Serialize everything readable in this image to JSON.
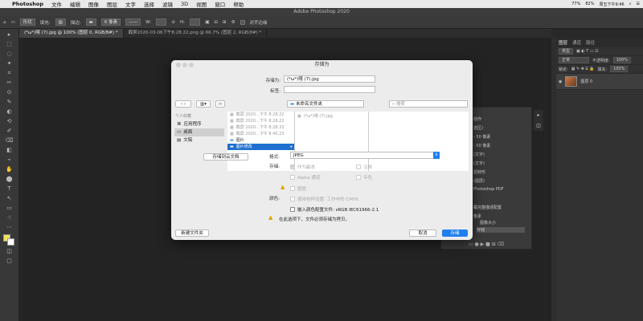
{
  "menubar": {
    "app": "Photoshop",
    "items": [
      "文件",
      "编辑",
      "图像",
      "图层",
      "文字",
      "选择",
      "滤镜",
      "3D",
      "视图",
      "窗口",
      "帮助"
    ],
    "status": {
      "battery": "77%",
      "wifi": "82%",
      "clock": "周五下午9:46"
    }
  },
  "ps_title": "Adobe Photoshop 2020",
  "options": {
    "shape": "形状",
    "fill": "填充:",
    "stroke": "描边:",
    "stroke_size": "6 像素",
    "w": "W:",
    "h": "H:",
    "align_edges": "对齐边缘"
  },
  "tabs": [
    "(*ω*)嘻 (7).jpg @ 100% (图层 0, RGB/8#) *",
    "截屏2020-03-06下午8.28.22.png @ 66.7% (图层 2, RGB/8#) *"
  ],
  "tools": [
    "▸",
    "⬚",
    "◌",
    "✦",
    "⌗",
    "✂",
    "⊙",
    "✎",
    "◐",
    "⟲",
    "✐",
    "⌫",
    "◧",
    "⌁",
    "✋",
    "⬤",
    "T",
    "↖",
    "▭",
    "☝",
    "⋯"
  ],
  "right_panel": {
    "tabs": [
      "图层",
      "通道",
      "路径"
    ],
    "kind": "类型",
    "blend": "正常",
    "opacity_label": "不透明度:",
    "opacity": "100%",
    "lock_label": "锁定:",
    "fill_label": "填充:",
    "fill": "100%",
    "layer_name": "图层 0"
  },
  "history": [
    "动作",
    "选区)",
    "- 50 像素",
    "- 50 像素",
    "(文字)",
    "(文字)",
    "扭转形",
    "(图层)",
    "Photoshop PDF",
    "",
    "覆完整描述配置",
    "像素",
    "图像大小",
    "存储"
  ],
  "dialog": {
    "title": "存储为",
    "save_as_label": "存储为:",
    "save_as_value": "(*ω*)嘻 (7).jpg",
    "tags_label": "标签:",
    "location": "未命名文件夹",
    "search_placeholder": "搜索",
    "sidebar_header": "个人收藏",
    "sidebar": [
      "应用程序",
      "桌面",
      "文稿"
    ],
    "col1": [
      "截屏 2020...下午 8.28.22",
      "截屏 2020...下午 8.28.22",
      "截屏 2020...下午 8.28.33",
      "截屏 2020...下午 8.40.23",
      "图片",
      "图片修改"
    ],
    "col2": [
      "(*ω*)嘻 (7).jpg"
    ],
    "save_cloud": "存储到云文档",
    "format_label": "格式:",
    "format_value": "JPEG",
    "storage_label": "存储:",
    "opt_copy": "作为副本",
    "opt_notes": "注释",
    "opt_alpha": "Alpha 通道",
    "opt_spot": "专色",
    "opt_layers": "图层",
    "color_label": "颜色:",
    "opt_proof": "使用校样设置: 工作中的 CMYK",
    "opt_icc": "嵌入颜色配置文件: sRGB IEC61966-2.1",
    "warn_text": "在此选项下，文件必须存储为拷贝。",
    "new_folder": "新建文件夹",
    "cancel": "取消",
    "save": "存储"
  }
}
